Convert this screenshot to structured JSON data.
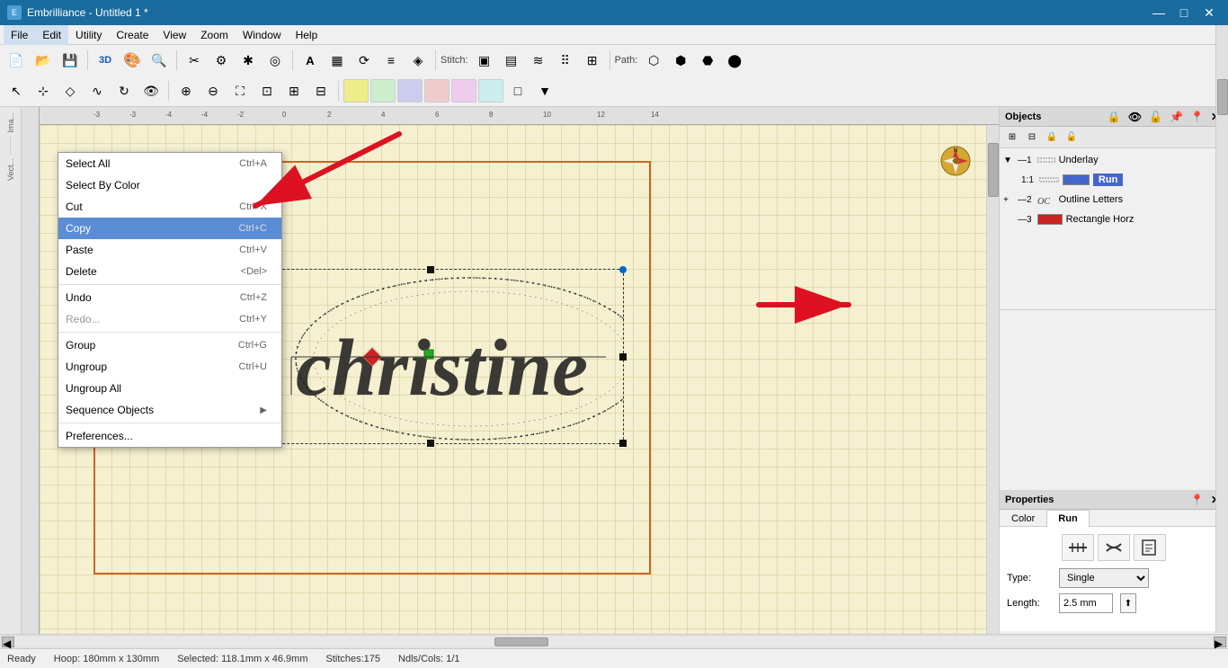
{
  "app": {
    "title": "Embrilliance - Untitled 1 *",
    "icon": "E"
  },
  "titlebar": {
    "minimize": "—",
    "maximize": "□",
    "close": "✕"
  },
  "menubar": {
    "items": [
      "File",
      "Edit",
      "Utility",
      "Create",
      "View",
      "Zoom",
      "Window",
      "Help"
    ]
  },
  "context_menu": {
    "items": [
      {
        "label": "Select All",
        "shortcut": "Ctrl+A",
        "disabled": false,
        "highlighted": false,
        "has_sub": false
      },
      {
        "label": "Select By Color",
        "shortcut": "",
        "disabled": false,
        "highlighted": false,
        "has_sub": false
      },
      {
        "label": "Cut",
        "shortcut": "Ctrl+X",
        "disabled": false,
        "highlighted": false,
        "has_sub": false
      },
      {
        "label": "Copy",
        "shortcut": "Ctrl+C",
        "disabled": false,
        "highlighted": true,
        "has_sub": false
      },
      {
        "label": "Paste",
        "shortcut": "Ctrl+V",
        "disabled": false,
        "highlighted": false,
        "has_sub": false
      },
      {
        "label": "Delete",
        "shortcut": "<Del>",
        "disabled": false,
        "highlighted": false,
        "has_sub": false
      },
      {
        "label": "",
        "shortcut": "",
        "separator": true
      },
      {
        "label": "Undo",
        "shortcut": "Ctrl+Z",
        "disabled": false,
        "highlighted": false,
        "has_sub": false
      },
      {
        "label": "Redo...",
        "shortcut": "Ctrl+Y",
        "disabled": true,
        "highlighted": false,
        "has_sub": false
      },
      {
        "label": "",
        "shortcut": "",
        "separator": true
      },
      {
        "label": "Group",
        "shortcut": "Ctrl+G",
        "disabled": false,
        "highlighted": false,
        "has_sub": false
      },
      {
        "label": "Ungroup",
        "shortcut": "Ctrl+U",
        "disabled": false,
        "highlighted": false,
        "has_sub": false
      },
      {
        "label": "Ungroup All",
        "shortcut": "",
        "disabled": false,
        "highlighted": false,
        "has_sub": false
      },
      {
        "label": "Sequence Objects",
        "shortcut": "",
        "disabled": false,
        "highlighted": false,
        "has_sub": true
      },
      {
        "label": "",
        "shortcut": "",
        "separator": true
      },
      {
        "label": "Preferences...",
        "shortcut": "",
        "disabled": false,
        "highlighted": false,
        "has_sub": false
      }
    ]
  },
  "objects_panel": {
    "title": "Objects",
    "items": [
      {
        "id": 1,
        "expandable": true,
        "expanded": true,
        "label": "Underlay",
        "color": null,
        "indent": 0
      },
      {
        "id": "1:1",
        "expandable": false,
        "expanded": false,
        "label": "Run",
        "color": "#4466cc",
        "indent": 1
      },
      {
        "id": 2,
        "expandable": false,
        "expanded": false,
        "label": "Outline Letters",
        "color": null,
        "indent": 0
      },
      {
        "id": 3,
        "expandable": false,
        "expanded": false,
        "label": "Rectangle Horz",
        "color": "#cc2222",
        "indent": 0
      }
    ]
  },
  "properties_panel": {
    "title": "Properties",
    "tabs": [
      "Color",
      "Run"
    ],
    "active_tab": "Run",
    "type_label": "Type:",
    "type_value": "Single",
    "length_label": "Length:",
    "length_value": "2.5 mm"
  },
  "statusbar": {
    "ready": "Ready",
    "hoop": "Hoop: 180mm x 130mm",
    "selected": "Selected: 118.1mm x 46.9mm",
    "stitches": "Stitches:175",
    "ndls_cols": "Ndls/Cols: 1/1"
  },
  "stitch_label": "Stitch:",
  "path_label": "Path:"
}
